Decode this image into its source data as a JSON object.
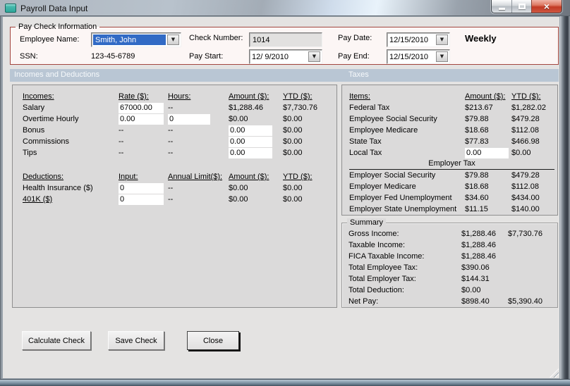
{
  "window": {
    "title": "Payroll Data Input"
  },
  "icons": {
    "dropdown": "▼",
    "close": "×"
  },
  "paycheck": {
    "legend": "Pay Check Information",
    "fields": {
      "employee_label": "Employee Name:",
      "employee_value": "Smith, John",
      "ssn_label": "SSN:",
      "ssn_value": "123-45-6789",
      "check_number_label": "Check Number:",
      "check_number_value": "1014",
      "pay_start_label": "Pay Start:",
      "pay_start_value": "12/ 9/2010",
      "pay_date_label": "Pay Date:",
      "pay_date_value": "12/15/2010",
      "pay_end_label": "Pay End:",
      "pay_end_value": "12/15/2010",
      "frequency": "Weekly"
    }
  },
  "section_headers": {
    "left": "Incomes and Deductions",
    "right": "Taxes"
  },
  "incomes": {
    "headers": [
      "Incomes:",
      "Rate ($):",
      "Hours:",
      "Amount ($):",
      "YTD ($):"
    ],
    "rows": [
      {
        "label": "Salary",
        "rate": "67000.00",
        "hours": "--",
        "amount": "$1,288.46",
        "ytd": "$7,730.76"
      },
      {
        "label": "Overtime Hourly",
        "rate": "0.00",
        "hours": "0",
        "amount": "$0.00",
        "ytd": "$0.00"
      },
      {
        "label": "Bonus",
        "rate": "--",
        "hours": "--",
        "amount": "0.00",
        "ytd": "$0.00"
      },
      {
        "label": "Commissions",
        "rate": "--",
        "hours": "--",
        "amount": "0.00",
        "ytd": "$0.00"
      },
      {
        "label": "Tips",
        "rate": "--",
        "hours": "--",
        "amount": "0.00",
        "ytd": "$0.00"
      }
    ]
  },
  "deductions": {
    "headers": [
      "Deductions:",
      "Input:",
      "Annual Limit($):",
      "Amount ($):",
      "YTD ($):"
    ],
    "rows": [
      {
        "label": "Health Insurance  ($)",
        "input": "0",
        "limit": "--",
        "amount": "$0.00",
        "ytd": "$0.00"
      },
      {
        "label": "401K  ($)",
        "input": "0",
        "limit": "--",
        "amount": "$0.00",
        "ytd": "$0.00"
      }
    ]
  },
  "taxes": {
    "headers": [
      "Items:",
      "Amount ($):",
      "YTD ($):"
    ],
    "employee_rows": [
      {
        "label": "Federal Tax",
        "amount": "$213.67",
        "ytd": "$1,282.02"
      },
      {
        "label": "Employee Social Security",
        "amount": "$79.88",
        "ytd": "$479.28"
      },
      {
        "label": "Employee Medicare",
        "amount": "$18.68",
        "ytd": "$112.08"
      },
      {
        "label": "State Tax",
        "amount": "$77.83",
        "ytd": "$466.98"
      },
      {
        "label": "Local Tax",
        "amount": "0.00",
        "ytd": "$0.00"
      }
    ],
    "divider": "Employer Tax",
    "employer_rows": [
      {
        "label": "Employer Social Security",
        "amount": "$79.88",
        "ytd": "$479.28"
      },
      {
        "label": "Employer Medicare",
        "amount": "$18.68",
        "ytd": "$112.08"
      },
      {
        "label": "Employer Fed Unemployment",
        "amount": "$34.60",
        "ytd": "$434.00"
      },
      {
        "label": "Employer State Unemployment",
        "amount": "$11.15",
        "ytd": "$140.00"
      }
    ]
  },
  "summary": {
    "legend": "Summary",
    "rows": [
      {
        "label": "Gross Income:",
        "amount": "$1,288.46",
        "ytd": "$7,730.76"
      },
      {
        "label": "Taxable Income:",
        "amount": "$1,288.46",
        "ytd": ""
      },
      {
        "label": "FICA Taxable Income:",
        "amount": "$1,288.46",
        "ytd": ""
      },
      {
        "label": "Total Employee Tax:",
        "amount": "$390.06",
        "ytd": ""
      },
      {
        "label": "Total Employer Tax:",
        "amount": "$144.31",
        "ytd": ""
      },
      {
        "label": "Total Deduction:",
        "amount": "$0.00",
        "ytd": ""
      },
      {
        "label": "Net Pay:",
        "amount": "$898.40",
        "ytd": "$5,390.40"
      }
    ]
  },
  "buttons": {
    "calculate": "Calculate Check",
    "save": "Save Check",
    "close": "Close"
  }
}
